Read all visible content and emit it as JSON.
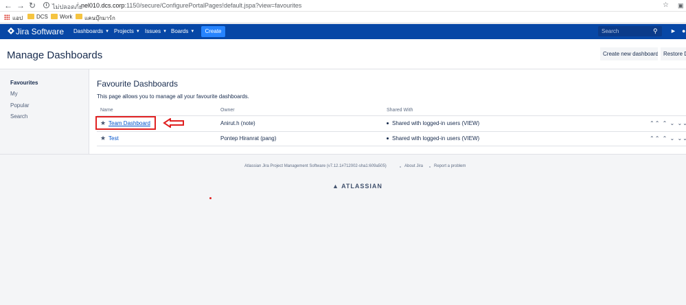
{
  "browser": {
    "back_icon": "arrow-left-icon",
    "forward_icon": "arrow-right-icon",
    "reload_icon": "reload-icon",
    "security_label": "ไม่ปลอดภัย",
    "url_host": "nel010.dcs.corp",
    "url_rest": ":1150/secure/ConfigurePortalPages!default.jspa?view=favourites",
    "bookmarks": [
      "แอป",
      "DCS",
      "Work",
      "แคนบุ๊กมาร์ก"
    ]
  },
  "jira": {
    "logo": "Jira Software",
    "menus": [
      "Dashboards",
      "Projects",
      "Issues",
      "Boards"
    ],
    "create_label": "Create",
    "search_placeholder": "Search"
  },
  "page": {
    "title": "Manage Dashboards",
    "create_new_label": "Create new dashboard",
    "restore_label": "Restore D"
  },
  "sidebar": {
    "items": [
      "Favourites",
      "My",
      "Popular",
      "Search"
    ]
  },
  "section": {
    "title": "Favourite Dashboards",
    "description": "This page allows you to manage all your favourite dashboards."
  },
  "table": {
    "headers": [
      "Name",
      "Owner",
      "Shared With"
    ],
    "rows": [
      {
        "name": "Team Dashboard",
        "owner": "Anirut.h (note)",
        "shared": "Shared with logged-in users (VIEW)"
      },
      {
        "name": "Test",
        "owner": "Pontep Hiranrat (pang)",
        "shared": "Shared with logged-in users (VIEW)"
      }
    ]
  },
  "footer": {
    "version": "Atlassian Jira Project Management Software (v7.12.1#712002-sha1:609a505)",
    "about": "About Jira",
    "report": "Report a problem",
    "brand": "ATLASSIAN"
  },
  "colors": {
    "header_bg": "#0747a6",
    "create_btn": "#2684ff",
    "link": "#0052cc",
    "annotation_red": "#e02020"
  }
}
